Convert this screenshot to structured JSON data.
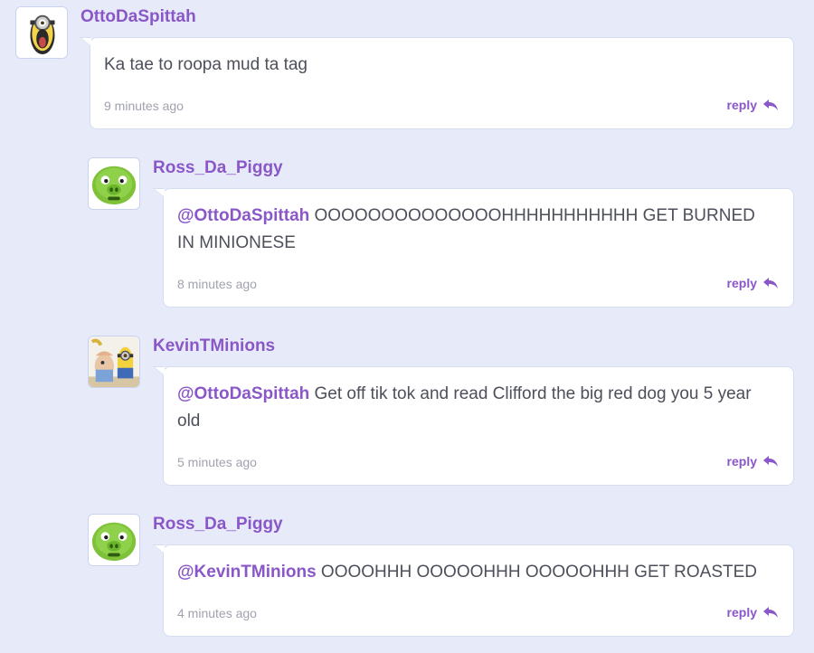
{
  "comments": [
    {
      "username": "OttoDaSpittah",
      "avatar_icon": "minion-tongue-avatar",
      "mention": "",
      "text": "Ka tae to roopa mud ta tag",
      "time": "9 minutes ago",
      "reply_label": "reply"
    },
    {
      "username": "Ross_Da_Piggy",
      "avatar_icon": "green-pig-avatar",
      "mention": "@OttoDaSpittah",
      "text": " OOOOOOOOOOOOOOHHHHHHHHHHH GET BURNED IN MINIONESE",
      "time": "8 minutes ago",
      "reply_label": "reply"
    },
    {
      "username": "KevinTMinions",
      "avatar_icon": "minions-avatar",
      "mention": "@OttoDaSpittah",
      "text": " Get off tik tok and read Clifford the big red dog you 5 year old",
      "time": "5 minutes ago",
      "reply_label": "reply"
    },
    {
      "username": "Ross_Da_Piggy",
      "avatar_icon": "green-pig-avatar",
      "mention": "@KevinTMinions",
      "text": " OOOOHHH OOOOOHHH OOOOOHHH GET ROASTED",
      "time": "4 minutes ago",
      "reply_label": "reply"
    }
  ],
  "colors": {
    "page_background": "#e7ebf9",
    "accent": "#8a57c8",
    "text": "#4d4f5a",
    "muted": "#a0a2ad"
  }
}
